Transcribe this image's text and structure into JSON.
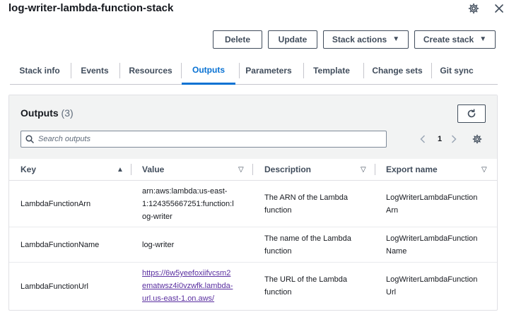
{
  "header": {
    "title": "log-writer-lambda-function-stack"
  },
  "actions": {
    "delete": "Delete",
    "update": "Update",
    "stack_actions": "Stack actions",
    "create_stack": "Create stack"
  },
  "tabs": [
    "Stack info",
    "Events",
    "Resources",
    "Outputs",
    "Parameters",
    "Template",
    "Change sets",
    "Git sync"
  ],
  "active_tab": "Outputs",
  "outputs": {
    "title": "Outputs",
    "count": "(3)",
    "search_placeholder": "Search outputs",
    "page": "1",
    "columns": [
      "Key",
      "Value",
      "Description",
      "Export name"
    ],
    "rows": [
      {
        "key": "LambdaFunctionArn",
        "value_lines": [
          "arn:aws:lambda:us-east-",
          "1:124355667251:function:l",
          "og-writer"
        ],
        "description_lines": [
          "The ARN of the Lambda",
          "function"
        ],
        "export_lines": [
          "LogWriterLambdaFunction",
          "Arn"
        ]
      },
      {
        "key": "LambdaFunctionName",
        "value_lines": [
          "log-writer"
        ],
        "description_lines": [
          "The name of the Lambda",
          "function"
        ],
        "export_lines": [
          "LogWriterLambdaFunction",
          "Name"
        ]
      },
      {
        "key": "LambdaFunctionUrl",
        "value_lines": [
          "https://6w5yeefoxiifvcsm2",
          "ematwsz4i0vzwfk.lambda-",
          "url.us-east-1.on.aws/"
        ],
        "description_lines": [
          "The URL of the Lambda",
          "function"
        ],
        "export_lines": [
          "LogWriterLambdaFunction",
          "Url"
        ]
      }
    ]
  },
  "icons": {
    "settings": "gear-icon",
    "close": "close-icon",
    "refresh": "refresh-icon",
    "search": "search-icon",
    "prev": "chevron-left-icon",
    "next": "chevron-right-icon",
    "preferences": "gear-icon",
    "sort_asc": "caret-up-icon",
    "sort": "caret-down-icon"
  },
  "colors": {
    "accent": "#0972d3",
    "link_visited": "#5a2fa0",
    "text": "#16191f",
    "button_border": "#414d5c"
  }
}
